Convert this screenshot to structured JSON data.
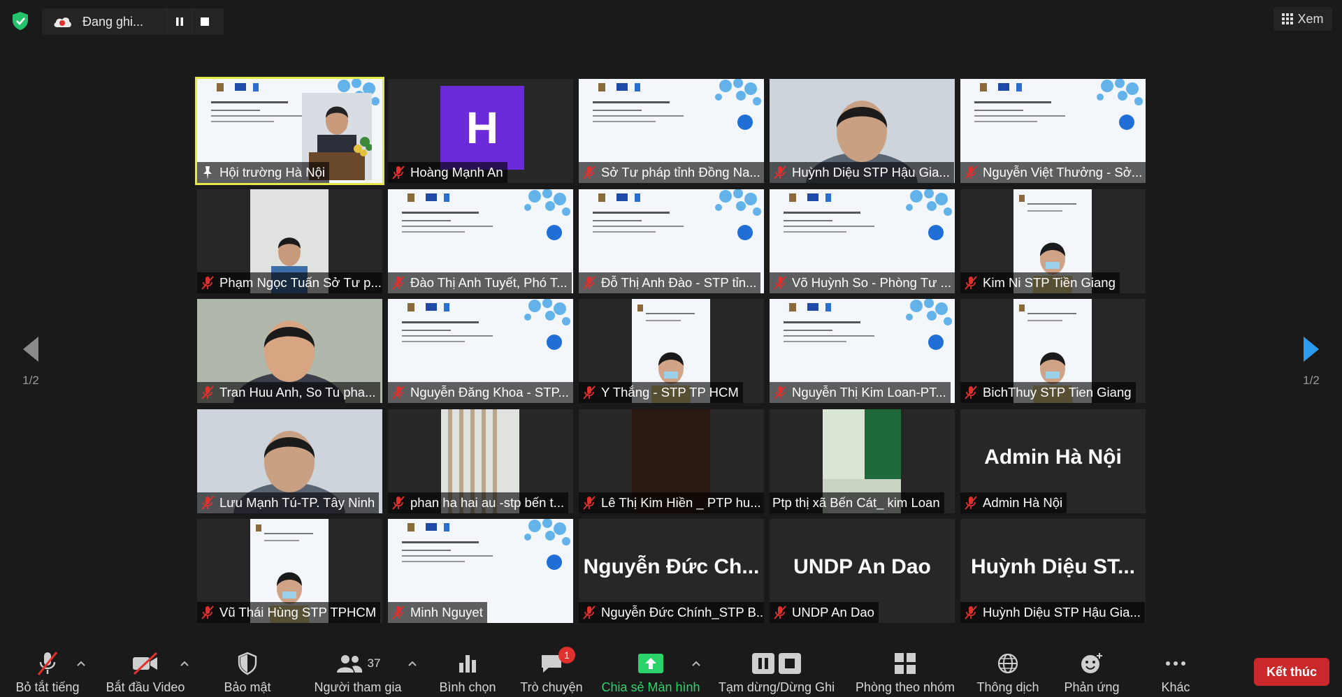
{
  "recording": {
    "status": "Đang ghi..."
  },
  "view_button": {
    "label": "Xem"
  },
  "pagination": {
    "left": "1/2",
    "right": "1/2"
  },
  "participants": [
    {
      "name": "Hội trường Hà Nội",
      "kind": "slide-speaker",
      "active": true,
      "icon": "pin-icon"
    },
    {
      "name": "Hoàng Mạnh An",
      "kind": "avatar",
      "avatar_letter": "H",
      "icon": "mic-muted-icon"
    },
    {
      "name": "Sở Tư pháp tỉnh Đồng Na...",
      "kind": "slide",
      "icon": "mic-muted-icon"
    },
    {
      "name": "Huỳnh Diệu STP Hậu Gia...",
      "kind": "person",
      "icon": "mic-muted-icon"
    },
    {
      "name": "Nguyễn Việt Thưởng - Sở...",
      "kind": "slide",
      "icon": "mic-muted-icon"
    },
    {
      "name": "Phạm Ngọc Tuấn Sở Tư p...",
      "kind": "narrow",
      "icon": "mic-muted-icon"
    },
    {
      "name": "Đào Thị Anh Tuyết, Phó T...",
      "kind": "slide",
      "icon": "mic-muted-icon"
    },
    {
      "name": "Đỗ Thị Anh Đào - STP tỉn...",
      "kind": "slide",
      "icon": "mic-muted-icon"
    },
    {
      "name": "Võ Huỳnh So - Phòng Tư ...",
      "kind": "slide",
      "icon": "mic-muted-icon"
    },
    {
      "name": "Kim Ni STP Tiền Giang",
      "kind": "narrow-slide",
      "icon": "mic-muted-icon"
    },
    {
      "name": "Tran Huu Anh, So Tu pha...",
      "kind": "person",
      "icon": "mic-muted-icon"
    },
    {
      "name": "Nguyễn Đăng Khoa - STP...",
      "kind": "slide",
      "icon": "mic-muted-icon"
    },
    {
      "name": "Y Thắng - STP TP HCM",
      "kind": "narrow-slide",
      "icon": "mic-muted-icon"
    },
    {
      "name": "Nguyễn Thị Kim Loan-PT...",
      "kind": "slide",
      "icon": "mic-muted-icon"
    },
    {
      "name": "BichThuy STP Tien Giang",
      "kind": "narrow-slide",
      "icon": "mic-muted-icon"
    },
    {
      "name": "Lưu Mạnh Tú-TP. Tây Ninh",
      "kind": "person",
      "icon": "mic-muted-icon"
    },
    {
      "name": "phan ha hai au -stp bến t...",
      "kind": "narrow",
      "icon": "mic-muted-icon"
    },
    {
      "name": "Lê Thị Kim Hiền _ PTP hu...",
      "kind": "narrow-dark",
      "icon": "mic-muted-icon"
    },
    {
      "name": "Ptp thị xã Bến Cát_ kim Loan",
      "kind": "narrow-green",
      "icon": ""
    },
    {
      "name": "Admin Hà Nội",
      "kind": "text",
      "display": "Admin Hà Nội",
      "icon": "mic-muted-icon"
    },
    {
      "name": "Vũ Thái Hùng STP TPHCM",
      "kind": "narrow-slide",
      "icon": "mic-muted-icon"
    },
    {
      "name": "Minh Nguyet",
      "kind": "slide",
      "icon": "mic-muted-icon"
    },
    {
      "name": "Nguyễn Đức Chính_STP B...",
      "kind": "text",
      "display": "Nguyễn Đức Ch...",
      "icon": "mic-muted-icon"
    },
    {
      "name": "UNDP An Dao",
      "kind": "text",
      "display": "UNDP An Dao",
      "icon": "mic-muted-icon"
    },
    {
      "name": "Huỳnh Diệu STP Hậu Gia...",
      "kind": "text",
      "display": "Huỳnh Diệu ST...",
      "icon": "mic-muted-icon"
    }
  ],
  "toolbar": {
    "mute": "Bỏ tắt tiếng",
    "video": "Bắt đầu Video",
    "security": "Bảo mật",
    "participants": "Người tham gia",
    "participants_count": "37",
    "polls": "Bình chọn",
    "chat": "Trò chuyện",
    "chat_badge": "1",
    "share": "Chia sẻ Màn hình",
    "record": "Tạm dừng/Dừng Ghi",
    "breakout": "Phòng theo nhóm",
    "interpretation": "Thông dịch",
    "reactions": "Phản ứng",
    "more": "Khác",
    "end": "Kết thúc"
  },
  "colors": {
    "active_speaker": "#e5e84a",
    "share_green": "#2bd46b",
    "end_red": "#c9292a",
    "avatar_purple": "#6c2bd9",
    "mic_muted_red": "#e0312f"
  }
}
